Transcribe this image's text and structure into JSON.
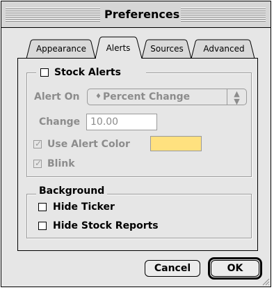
{
  "window": {
    "title": "Preferences"
  },
  "tabs": [
    {
      "label": "Appearance",
      "selected": false
    },
    {
      "label": "Alerts",
      "selected": true
    },
    {
      "label": "Sources",
      "selected": false
    },
    {
      "label": "Advanced",
      "selected": false
    }
  ],
  "stock_alerts": {
    "label": "Stock Alerts",
    "checked": false,
    "alert_on_label": "Alert On",
    "alert_on_value": "Percent Change",
    "alert_on_marker": "♦",
    "change_label": "Change",
    "change_value": "10.00",
    "use_alert_color_label": "Use Alert Color",
    "use_alert_color_checked": true,
    "alert_color": "#ffe17f",
    "blink_label": "Blink",
    "blink_checked": true
  },
  "background": {
    "label": "Background",
    "hide_ticker_label": "Hide Ticker",
    "hide_ticker_checked": false,
    "hide_reports_label": "Hide Stock Reports",
    "hide_reports_checked": false
  },
  "buttons": {
    "cancel_label": "Cancel",
    "ok_label": "OK"
  },
  "icons": {
    "check": "✓",
    "popup_arrows": "⬍"
  }
}
